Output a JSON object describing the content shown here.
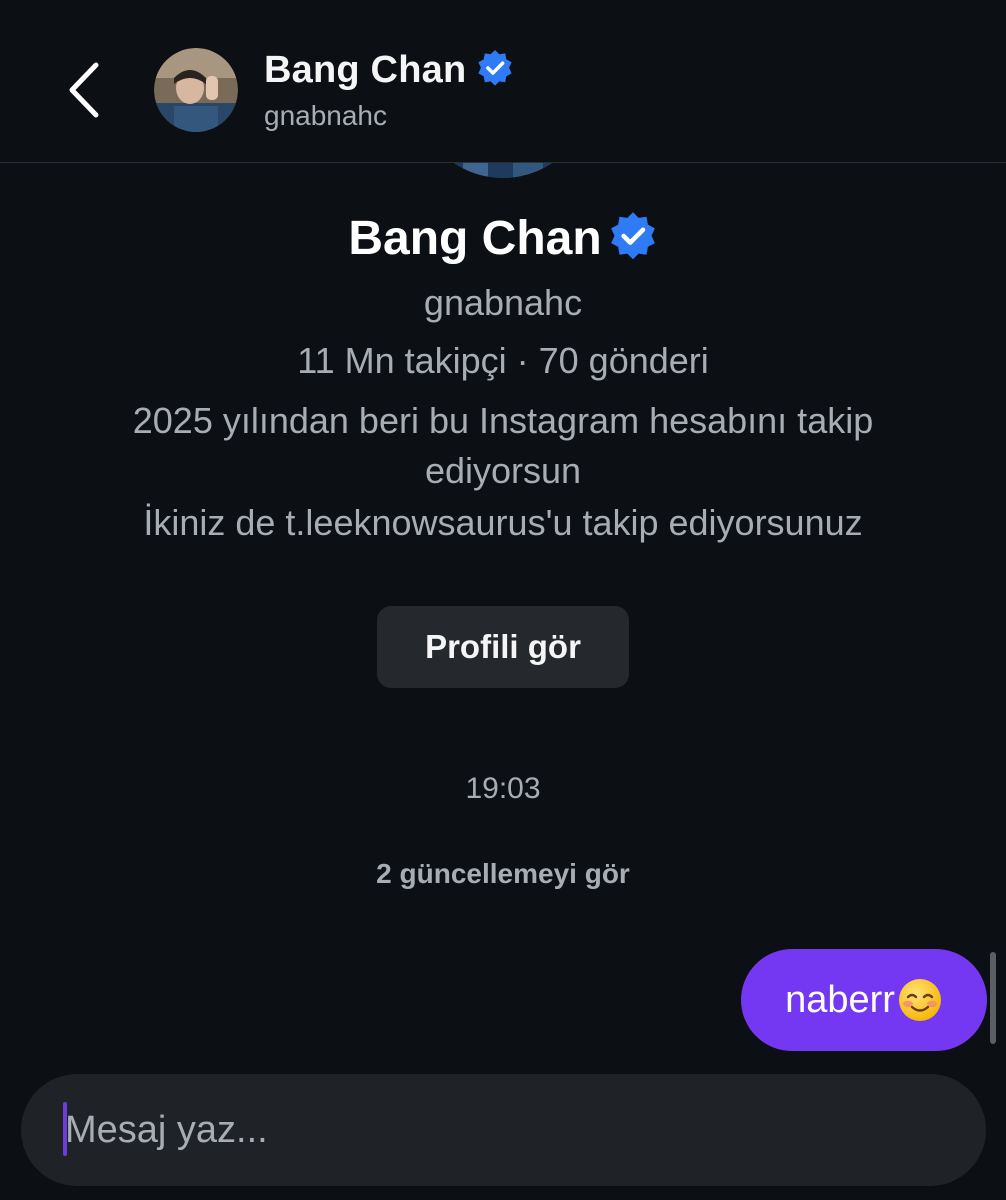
{
  "header": {
    "back_icon": "chevron-left-icon",
    "avatar_icon": "profile-avatar",
    "name": "Bang Chan",
    "verified_icon": "verified-badge-icon",
    "username": "gnabnahc"
  },
  "profile": {
    "name": "Bang Chan",
    "username": "gnabnahc",
    "stats": "11 Mn takipçi · 70 gönderi",
    "follow_since": "2025 yılından beri bu Instagram hesabını takip ediyorsun",
    "mutual": "İkiniz de t.leeknowsaurus'u takip ediyorsunuz",
    "view_profile_label": "Profili gör"
  },
  "conversation": {
    "timestamp": "19:03",
    "updates_label": "2 güncellemeyi gör",
    "messages": [
      {
        "sender": "me",
        "text": "naberr",
        "emoji": "smiling-face-icon"
      }
    ]
  },
  "composer": {
    "placeholder": "Mesaj yaz..."
  },
  "colors": {
    "background": "#0c1014",
    "bubble": "#7438f3",
    "button": "#25292e",
    "composer": "#1f2327",
    "verified": "#2f7bf6",
    "secondary_text": "#a8adb3"
  }
}
